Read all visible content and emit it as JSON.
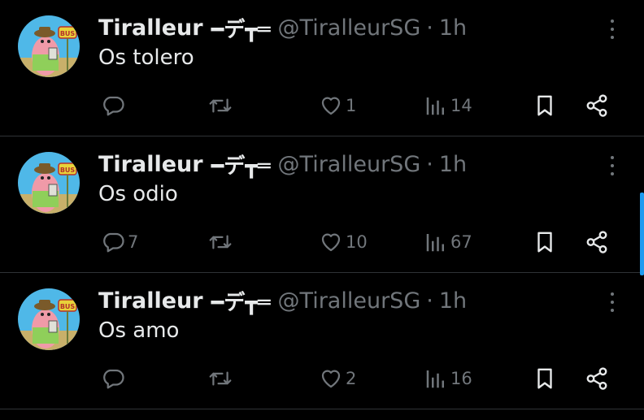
{
  "colors": {
    "background": "#000000",
    "text_primary": "#e7e9ea",
    "text_secondary": "#71767b",
    "divider": "#2f3336",
    "scroll_accent": "#1d9bf0"
  },
  "tweets": [
    {
      "display_name": "Tiralleur",
      "name_decoration": "━デ┳═",
      "handle": "@TiralleurSG",
      "separator": "·",
      "time": "1h",
      "text": "Os tolero",
      "actions": {
        "reply": {
          "icon": "reply-icon",
          "count": ""
        },
        "retweet": {
          "icon": "retweet-icon",
          "count": ""
        },
        "like": {
          "icon": "heart-icon",
          "count": "1"
        },
        "views": {
          "icon": "views-icon",
          "count": "14"
        },
        "bookmark": {
          "icon": "bookmark-icon"
        },
        "share": {
          "icon": "share-icon"
        }
      }
    },
    {
      "display_name": "Tiralleur",
      "name_decoration": "━デ┳═",
      "handle": "@TiralleurSG",
      "separator": "·",
      "time": "1h",
      "text": "Os odio",
      "actions": {
        "reply": {
          "icon": "reply-icon",
          "count": "7"
        },
        "retweet": {
          "icon": "retweet-icon",
          "count": ""
        },
        "like": {
          "icon": "heart-icon",
          "count": "10"
        },
        "views": {
          "icon": "views-icon",
          "count": "67"
        },
        "bookmark": {
          "icon": "bookmark-icon"
        },
        "share": {
          "icon": "share-icon"
        }
      }
    },
    {
      "display_name": "Tiralleur",
      "name_decoration": "━デ┳═",
      "handle": "@TiralleurSG",
      "separator": "·",
      "time": "1h",
      "text": "Os amo",
      "actions": {
        "reply": {
          "icon": "reply-icon",
          "count": ""
        },
        "retweet": {
          "icon": "retweet-icon",
          "count": ""
        },
        "like": {
          "icon": "heart-icon",
          "count": "2"
        },
        "views": {
          "icon": "views-icon",
          "count": "16"
        },
        "bookmark": {
          "icon": "bookmark-icon"
        },
        "share": {
          "icon": "share-icon"
        }
      }
    }
  ]
}
